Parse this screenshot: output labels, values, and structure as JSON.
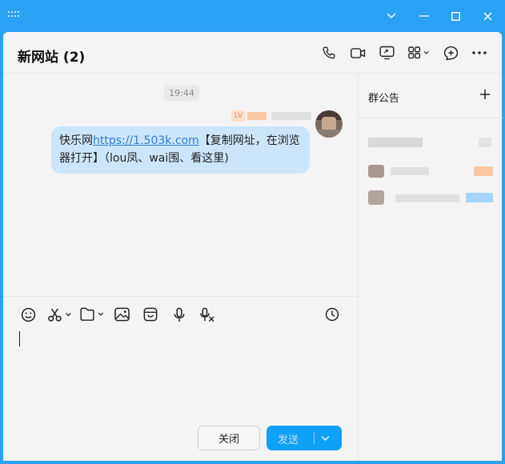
{
  "window": {
    "controls": [
      "chevron-down-icon",
      "minimize-icon",
      "maximize-icon",
      "close-icon"
    ]
  },
  "header": {
    "title": "新网站 (2)",
    "actions": [
      "phone-icon",
      "video-icon",
      "screen-share-icon",
      "apps-icon",
      "add-icon",
      "more-icon"
    ]
  },
  "chat": {
    "time": "19:44",
    "sender_level": "LV",
    "message": {
      "prefix": "快乐网",
      "link": "https://1.503k.com",
      "suffix": "【复制网址，在浏览器打开】（lou凤、wai围、看这里)"
    }
  },
  "composer": {
    "tools": [
      "emoji-icon",
      "scissors-icon",
      "folder-icon",
      "image-icon",
      "sticker-icon",
      "microphone-icon",
      "voice-to-text-icon",
      "history-icon"
    ],
    "close_label": "关闭",
    "send_label": "发送"
  },
  "sidebar": {
    "title": "群公告",
    "add_symbol": "+"
  },
  "colors": {
    "titlebar": "#2aa2f3",
    "bubble": "#cbe6fb",
    "link": "#2d7fd3",
    "send_button": "#0fa0f7"
  }
}
